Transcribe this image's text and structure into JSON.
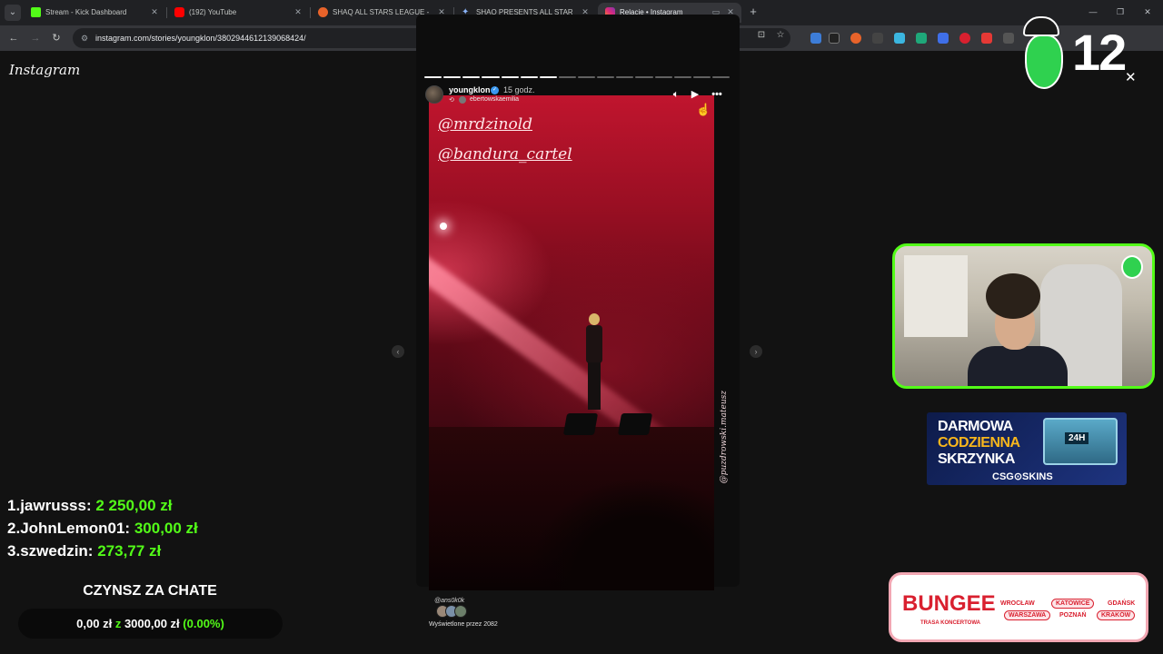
{
  "browser": {
    "tabs": [
      {
        "label": "Stream - Kick Dashboard",
        "favicon_color": "#53fc18",
        "active": false
      },
      {
        "label": "(192) YouTube",
        "favicon_color": "#ff0000",
        "active": false
      },
      {
        "label": "SHAQ ALL STARS LEAGUE -",
        "favicon_color": "#e8632a",
        "active": false
      },
      {
        "label": "SHAQ PRESENTS ALL STARS LE",
        "favicon_color": "#8ab4f8",
        "active": false
      },
      {
        "label": "Relacje • Instagram",
        "favicon_color": "#e1306c",
        "active": true
      }
    ],
    "url": "instagram.com/stories/youngklon/3802944612139068424/"
  },
  "instagram": {
    "logo": "Instagram",
    "story": {
      "username": "youngklon",
      "time": "15 godz.",
      "reposted_from": "ebertowskaemilia",
      "mentions": [
        "@mrdzinold",
        "@bandura_cartel"
      ],
      "credit": "@puzdrowski.mateusz",
      "viewers_tag": "@ans0k0k",
      "viewers_text": "Wyświetlone przez 2082",
      "segments_total": 16,
      "segments_done": 7
    }
  },
  "overlay": {
    "donations": [
      {
        "rank": "1.",
        "name": "jawrusss:",
        "amount": "2 250,00 zł"
      },
      {
        "rank": "2.",
        "name": "JohnLemon01:",
        "amount": "300,00 zł"
      },
      {
        "rank": "3.",
        "name": "szwedzin:",
        "amount": "273,77 zł"
      }
    ],
    "rent_title": "CZYNSZ ZA CHATE",
    "rent_current": "0,00 zł",
    "rent_sep": "z",
    "rent_goal": "3000,00 zł",
    "rent_percent": "(0.00%)",
    "counter": "12",
    "accent_color": "#53fc18"
  },
  "ads": {
    "csgo": {
      "line1": "DARMOWA",
      "line2": "CODZIENNA",
      "line3": "SKRZYNKA",
      "box_label": "24H",
      "brand": "CSG⊙SKINS"
    },
    "bungee": {
      "logo": "BUNGEE",
      "subtitle": "TRASA KONCERTOWA",
      "cities": [
        "WROCŁAW",
        "KATOWICE",
        "GDAŃSK",
        "WARSZAWA",
        "POZNAŃ",
        "KRAKÓW"
      ]
    }
  }
}
